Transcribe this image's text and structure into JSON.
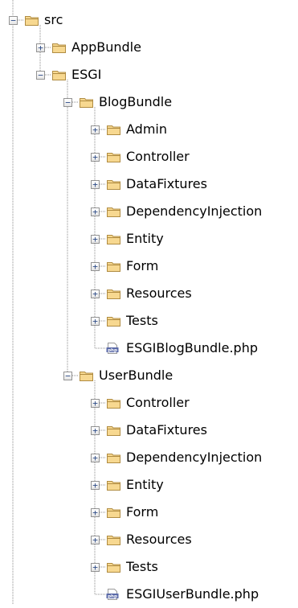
{
  "colors": {
    "folder_fill": "#f7d890",
    "folder_stroke": "#b08c42",
    "tree_line": "#8c8c8c",
    "php_badge": "#5b6aa8"
  },
  "icons": {
    "folder": "folder-icon",
    "php_file": "php-file-icon",
    "expanded": "minus",
    "collapsed": "plus"
  },
  "tree": {
    "root": {
      "label": "src",
      "state": "expanded",
      "children": [
        {
          "label": "AppBundle",
          "type": "folder",
          "state": "collapsed"
        },
        {
          "label": "ESGI",
          "type": "folder",
          "state": "expanded",
          "children": [
            {
              "label": "BlogBundle",
              "type": "folder",
              "state": "expanded",
              "children": [
                {
                  "label": "Admin",
                  "type": "folder",
                  "state": "collapsed"
                },
                {
                  "label": "Controller",
                  "type": "folder",
                  "state": "collapsed"
                },
                {
                  "label": "DataFixtures",
                  "type": "folder",
                  "state": "collapsed"
                },
                {
                  "label": "DependencyInjection",
                  "type": "folder",
                  "state": "collapsed"
                },
                {
                  "label": "Entity",
                  "type": "folder",
                  "state": "collapsed"
                },
                {
                  "label": "Form",
                  "type": "folder",
                  "state": "collapsed"
                },
                {
                  "label": "Resources",
                  "type": "folder",
                  "state": "collapsed"
                },
                {
                  "label": "Tests",
                  "type": "folder",
                  "state": "collapsed"
                },
                {
                  "label": "ESGIBlogBundle.php",
                  "type": "php",
                  "badge": "php"
                }
              ]
            },
            {
              "label": "UserBundle",
              "type": "folder",
              "state": "expanded",
              "children": [
                {
                  "label": "Controller",
                  "type": "folder",
                  "state": "collapsed"
                },
                {
                  "label": "DataFixtures",
                  "type": "folder",
                  "state": "collapsed"
                },
                {
                  "label": "DependencyInjection",
                  "type": "folder",
                  "state": "collapsed"
                },
                {
                  "label": "Entity",
                  "type": "folder",
                  "state": "collapsed"
                },
                {
                  "label": "Form",
                  "type": "folder",
                  "state": "collapsed"
                },
                {
                  "label": "Resources",
                  "type": "folder",
                  "state": "collapsed"
                },
                {
                  "label": "Tests",
                  "type": "folder",
                  "state": "collapsed"
                },
                {
                  "label": "ESGIUserBundle.php",
                  "type": "php",
                  "badge": "php"
                }
              ]
            }
          ]
        }
      ]
    }
  }
}
